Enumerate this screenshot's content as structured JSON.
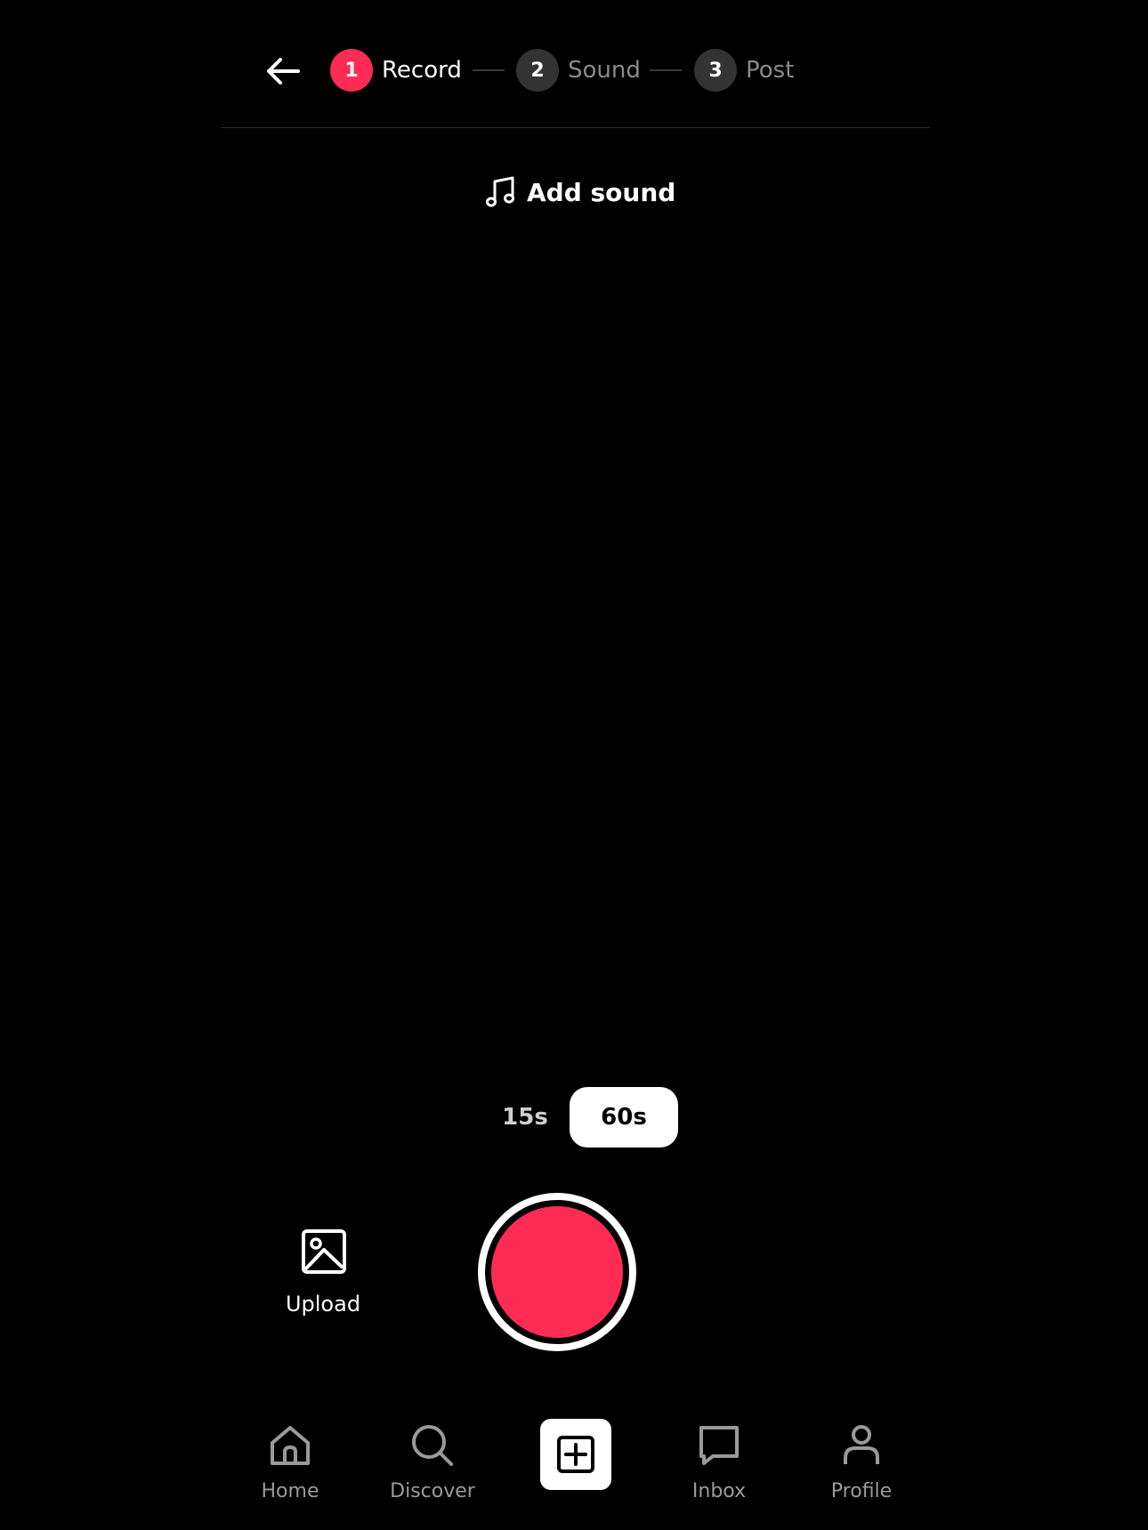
{
  "header": {
    "steps": [
      {
        "number": "1",
        "label": "Record",
        "active": true
      },
      {
        "number": "2",
        "label": "Sound",
        "active": false
      },
      {
        "number": "3",
        "label": "Post",
        "active": false
      }
    ]
  },
  "add_sound": {
    "label": "Add sound",
    "icon": "music-note-icon"
  },
  "durations": [
    {
      "label": "15s",
      "selected": false
    },
    {
      "label": "60s",
      "selected": true
    }
  ],
  "upload": {
    "label": "Upload",
    "icon": "image-icon"
  },
  "record": {
    "icon": "record-button"
  },
  "nav": {
    "items": [
      {
        "label": "Home",
        "icon": "home-icon"
      },
      {
        "label": "Discover",
        "icon": "search-icon"
      },
      {
        "label": "Inbox",
        "icon": "message-icon"
      },
      {
        "label": "Profile",
        "icon": "person-icon"
      }
    ],
    "create_icon": "plus-square-icon"
  },
  "colors": {
    "background": "#000000",
    "accent": "#fe2c55",
    "inactive_step": "#333333",
    "muted_text": "#9a9a9a"
  }
}
